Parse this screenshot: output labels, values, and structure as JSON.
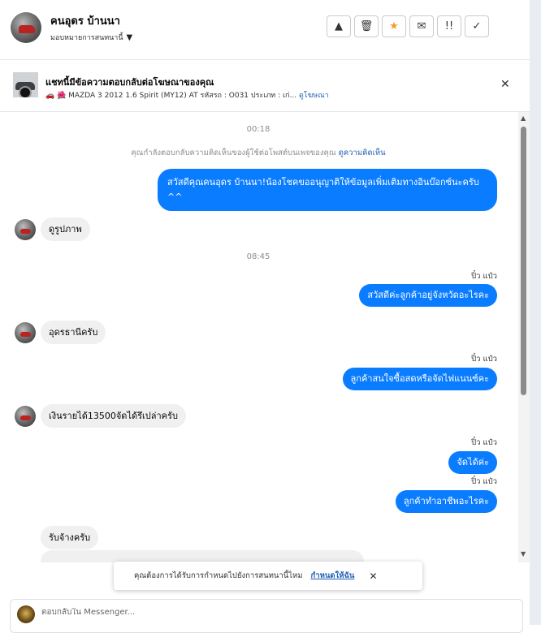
{
  "header": {
    "contact_name": "คนอุดร บ้านนา",
    "assign_label": "มอบหมายการสนทนานี้",
    "actions": [
      {
        "icon": "warning-icon",
        "glyph": "▲"
      },
      {
        "icon": "trash-icon",
        "glyph": "🗑"
      },
      {
        "icon": "star-icon",
        "glyph": "★"
      },
      {
        "icon": "mail-icon",
        "glyph": "✉"
      },
      {
        "icon": "follow-up-icon",
        "glyph": "!!"
      },
      {
        "icon": "check-icon",
        "glyph": "✓"
      }
    ]
  },
  "ad": {
    "title": "แชทนี้มีข้อความตอบกลับต่อโฆษณาของคุณ",
    "description": "🚗 🌺 MAZDA 3 2012 1.6 Spirit (MY12) AT รหัสรถ : O031 ประเภท : เก่...",
    "link_label": "ดูโฆษณา",
    "close_glyph": "✕"
  },
  "chat": {
    "timestamp_1": "00:18",
    "reply_note": "คุณกำลังตอบกลับความคิดเห็นของผู้ใช้ต่อโพสต์บนเพจของคุณ",
    "reply_note_link": "ดูความคิดเห็น",
    "msg_out_1": "สวัสดีคุณคนอุดร บ้านนา!น้องโชคขออนุญาติให้ข้อมูลเพิ่มเติมทางอินบ๊อกซ์นะครับ ^^",
    "msg_in_1": "ดูรูปภาพ",
    "timestamp_2": "08:45",
    "sender_1": "ปิ๋ว แป๋ว",
    "msg_out_2": "สวัสดีค่ะลูกค้าอยู่จังหวัดอะไรคะ",
    "msg_in_2": "อุดรธานีครับ",
    "sender_2": "ปิ๋ว แป๋ว",
    "msg_out_3": "ลูกค้าสนใจซื้อสดหรือจัดไฟแนนซ์คะ",
    "msg_in_3": "เงินรายได้13500จัดได้รึเปล่าครับ",
    "sender_3": "ปิ๋ว แป๋ว",
    "msg_out_4": "จัดได้ค่ะ",
    "sender_4": "ปิ๋ว แป๋ว",
    "msg_out_5": "ลูกค้าทำอาชีพอะไรคะ",
    "msg_in_4": "รับจ้างครับ"
  },
  "assign_popup": {
    "text": "คุณต้องการได้รับการกำหนดไปยังการสนทนานี้ไหม",
    "link_label": "กำหนดให้ฉัน",
    "close_glyph": "✕"
  },
  "composer": {
    "placeholder": "ตอบกลับใน Messenger..."
  }
}
